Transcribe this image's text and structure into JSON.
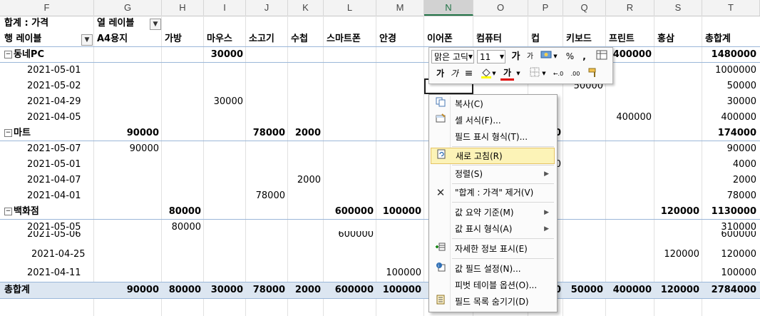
{
  "columns": [
    "F",
    "G",
    "H",
    "I",
    "J",
    "K",
    "L",
    "M",
    "N",
    "O",
    "P",
    "Q",
    "R",
    "S",
    "T"
  ],
  "selected_column": "N",
  "pivot": {
    "sum_label": "합계 : 가격",
    "col_labels_caption": "열 레이블",
    "row_labels_caption": "행 레이블",
    "headers": [
      "A4용지",
      "가방",
      "마우스",
      "소고기",
      "수첩",
      "스마트폰",
      "안경",
      "이어폰",
      "컴퓨터",
      "컵",
      "키보드",
      "프린트",
      "홍삼",
      "총합계"
    ],
    "rows": {
      "g1": {
        "name": "동네PC",
        "i": "30000",
        "r": "400000",
        "total": "1480000"
      },
      "g1_r1": {
        "date": "2021-05-01",
        "total": "1000000"
      },
      "g1_r2": {
        "date": "2021-05-02",
        "q": "50000",
        "total": "50000"
      },
      "g1_r3": {
        "date": "2021-04-29",
        "i": "30000",
        "total": "30000"
      },
      "g1_r4": {
        "date": "2021-04-05",
        "r": "400000",
        "total": "400000"
      },
      "g2": {
        "name": "마트",
        "g": "90000",
        "j": "78000",
        "k": "2000",
        "o_partial": "0",
        "total": "174000"
      },
      "g2_r1": {
        "date": "2021-05-07",
        "g": "90000",
        "total": "90000"
      },
      "g2_r2": {
        "date": "2021-05-01",
        "o_partial": "0",
        "total": "4000"
      },
      "g2_r3": {
        "date": "2021-04-07",
        "k": "2000",
        "total": "2000"
      },
      "g2_r4": {
        "date": "2021-04-01",
        "j": "78000",
        "total": "78000"
      },
      "g3": {
        "name": "백화점",
        "h": "80000",
        "l": "600000",
        "m": "100000",
        "s": "120000",
        "total": "1130000"
      },
      "g3_r1": {
        "date": "2021-05-05",
        "h": "80000",
        "total": "310000"
      },
      "g3_r2": {
        "date": "2021-05-06",
        "l": "600000",
        "total": "600000"
      },
      "g3_r3": {
        "date": "2021-04-25",
        "s": "120000",
        "total": "120000"
      },
      "g3_r4": {
        "date": "2021-04-11",
        "m": "100000",
        "total": "100000"
      },
      "grand": {
        "name": "총합계",
        "g": "90000",
        "h": "80000",
        "i": "30000",
        "j": "78000",
        "k": "2000",
        "l": "600000",
        "m": "100000",
        "o_partial": "0",
        "q": "50000",
        "r": "400000",
        "s": "120000",
        "total": "2784000"
      }
    }
  },
  "mini_toolbar": {
    "font_name": "맑은 고딕",
    "font_size": "11",
    "grow_font": "가",
    "shrink_font": "가",
    "percent": "%",
    "comma": ",",
    "bold": "가",
    "italic": "가",
    "font_color": "가",
    "dec_inc": "←.0",
    "dec_dec": ".00"
  },
  "context_menu": [
    {
      "label": "복사(C)",
      "icon": "copy-icon",
      "submenu": false
    },
    {
      "label": "셀 서식(F)...",
      "icon": "format-cells-icon",
      "submenu": false
    },
    {
      "label": "필드 표시 형식(T)...",
      "icon": "",
      "submenu": false
    },
    {
      "label": "새로 고침(R)",
      "icon": "refresh-icon",
      "submenu": false,
      "highlighted": true
    },
    {
      "label": "정렬(S)",
      "icon": "",
      "submenu": true
    },
    {
      "label": "\"합계 : 가격\" 제거(V)",
      "icon": "remove-icon",
      "submenu": false
    },
    {
      "label": "값 요약 기준(M)",
      "icon": "",
      "submenu": true
    },
    {
      "label": "값 표시 형식(A)",
      "icon": "",
      "submenu": true
    },
    {
      "label": "자세한 정보 표시(E)",
      "icon": "show-details-icon",
      "submenu": false
    },
    {
      "label": "값 필드 설정(N)...",
      "icon": "field-settings-icon",
      "submenu": false
    },
    {
      "label": "피벗 테이블 옵션(O)...",
      "icon": "",
      "submenu": false
    },
    {
      "label": "필드 목록 숨기기(D)",
      "icon": "field-list-icon",
      "submenu": false
    }
  ]
}
